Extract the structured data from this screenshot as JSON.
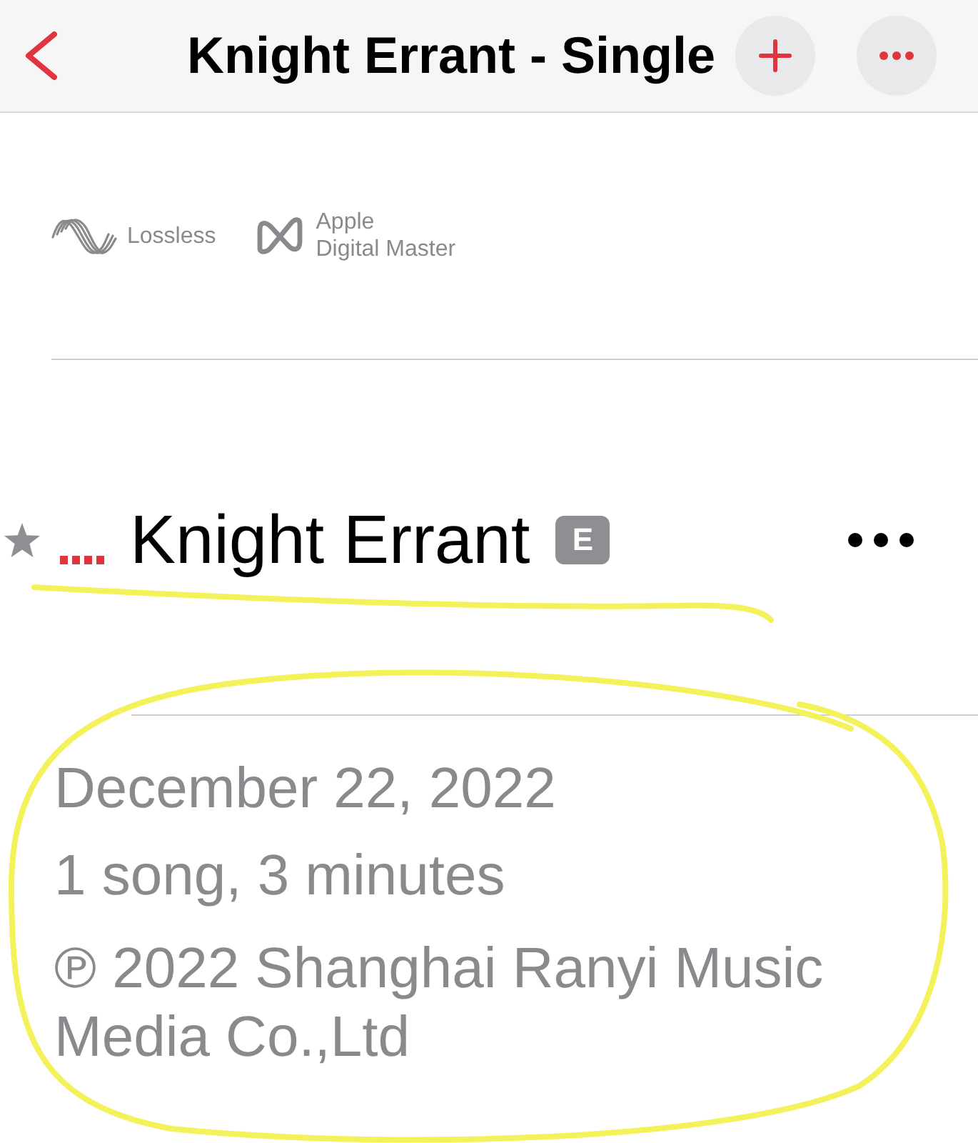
{
  "nav_bar": {
    "title": "Knight Errant - Single"
  },
  "audio_badges": [
    {
      "kind": "lossless",
      "label_lines": [
        "Lossless"
      ]
    },
    {
      "kind": "digital_master",
      "label_lines": [
        "Apple",
        "Digital Master"
      ]
    }
  ],
  "track": {
    "favorited": true,
    "title": "Knight Errant",
    "explicit_badge": "E",
    "underlined": true
  },
  "details": {
    "release_date": "December 22, 2022",
    "summary": "1 song, 3 minutes",
    "copyright": "℗ 2022 Shanghai Ranyi Music Media Co.,Ltd",
    "circled": true
  }
}
